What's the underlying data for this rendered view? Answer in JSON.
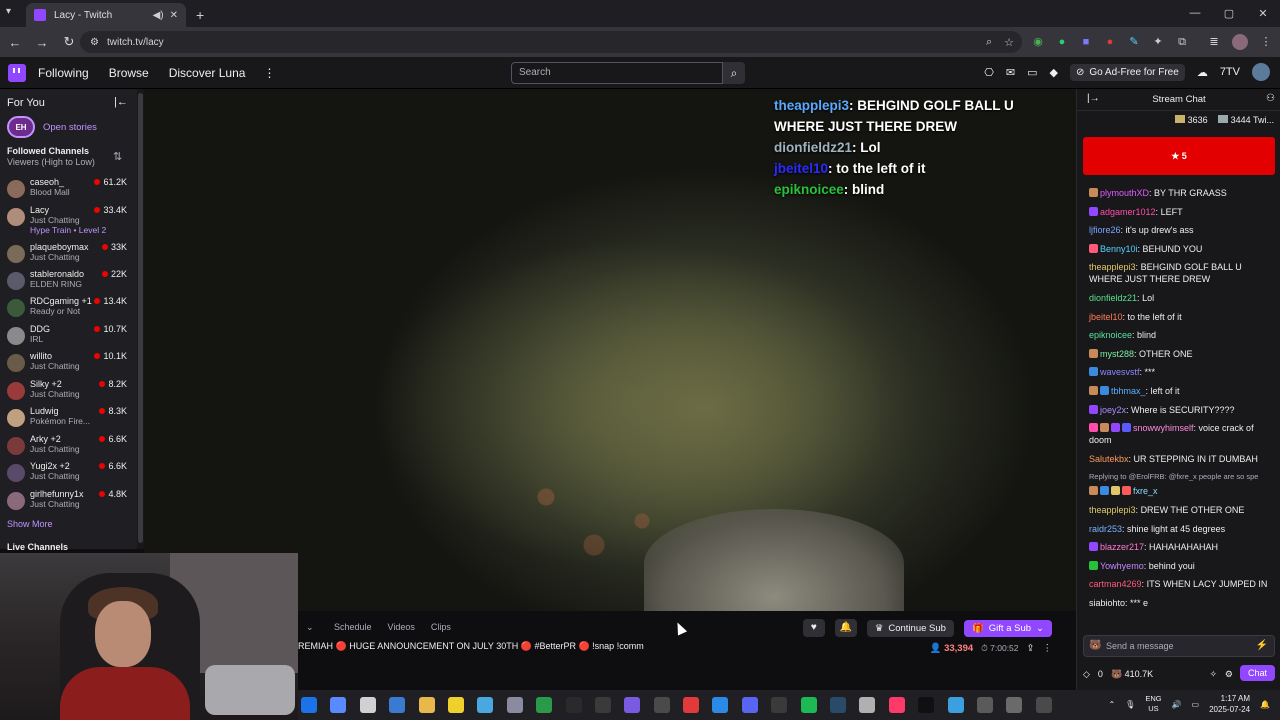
{
  "browser": {
    "tab_title": "Lacy - Twitch",
    "url": "twitch.tv/lacy"
  },
  "nav": {
    "following": "Following",
    "browse": "Browse",
    "discover": "Discover Luna",
    "search_placeholder": "Search",
    "adfree": "Go Ad-Free for Free"
  },
  "sidebar": {
    "for_you": "For You",
    "open_stories": "Open stories",
    "stories_badge": "EH",
    "followed_title": "Followed Channels",
    "followed_sort": "Viewers (High to Low)",
    "channels": [
      {
        "name": "caseoh_",
        "game": "Blood Mall",
        "viewers": "61.2K",
        "color": "#8a6a5a"
      },
      {
        "name": "Lacy",
        "game": "Just Chatting",
        "extra": "Hype Train • Level 2",
        "viewers": "33.4K",
        "color": "#b08c7a"
      },
      {
        "name": "plaqueboymax",
        "game": "Just Chatting",
        "viewers": "33K",
        "color": "#7a6a58"
      },
      {
        "name": "stableronaldo",
        "game": "ELDEN RING",
        "viewers": "22K",
        "color": "#5a5a6a"
      },
      {
        "name": "RDCgaming +1",
        "game": "Ready or Not",
        "viewers": "13.4K",
        "color": "#3a5a3a"
      },
      {
        "name": "DDG",
        "game": "IRL",
        "viewers": "10.7K",
        "color": "#8a8a8a"
      },
      {
        "name": "willito",
        "game": "Just Chatting",
        "viewers": "10.1K",
        "color": "#6a5a4a"
      },
      {
        "name": "Silky +2",
        "game": "Just Chatting",
        "viewers": "8.2K",
        "color": "#9a3a3a"
      },
      {
        "name": "Ludwig",
        "game": "Pokémon Fire...",
        "viewers": "8.3K",
        "color": "#c0a080"
      },
      {
        "name": "Arky +2",
        "game": "Just Chatting",
        "viewers": "6.6K",
        "color": "#7a3a3a"
      },
      {
        "name": "Yugi2x +2",
        "game": "Just Chatting",
        "viewers": "6.6K",
        "color": "#5a4a6a"
      },
      {
        "name": "girlhefunny1x",
        "game": "Just Chatting",
        "viewers": "4.8K",
        "color": "#8a6a7a"
      }
    ],
    "show_more": "Show More",
    "live_channels": "Live Channels"
  },
  "overlay_chat": [
    {
      "user": "theapplepi3",
      "text": "BEHGIND GOLF BALL U WHERE JUST THERE DREW",
      "color": "#5aa9ff"
    },
    {
      "user": "dionfieldz21",
      "text": "Lol",
      "color": "#9fb4c0"
    },
    {
      "user": "jbeitel10",
      "text": "to the left of it",
      "color": "#2b2bff"
    },
    {
      "user": "epiknoicee",
      "text": "blind",
      "color": "#27c23a"
    }
  ],
  "below": {
    "schedule": "Schedule",
    "videos": "Videos",
    "clips": "Clips",
    "title": "REMIAH 🔴 HUGE ANNOUNCEMENT ON JULY 30TH 🔴 #BetterPR 🔴 !snap !comm",
    "continue_sub": "Continue Sub",
    "gift_sub": "Gift a Sub",
    "viewers": "33,394",
    "uptime": "7:00:52"
  },
  "chat": {
    "title": "Stream Chat",
    "board1": "3636",
    "board2": "3444",
    "board2_label": "Twi...",
    "hype": "5",
    "messages": [
      {
        "user": "plymouthXD",
        "text": "BY THR GRAASS",
        "color": "#e05cff",
        "badges": [
          "#c98a5a"
        ]
      },
      {
        "user": "adgamer1012",
        "text": "LEFT",
        "color": "#ff4fa8",
        "badges": [
          "#9147ff"
        ]
      },
      {
        "user": "ljfiore26",
        "text": "it's up drew's ass",
        "color": "#7aa7ff",
        "badges": []
      },
      {
        "user": "Benny10i",
        "text": "BEHUND YOU",
        "color": "#5ad0ff",
        "badges": [
          "#ff5a7a"
        ]
      },
      {
        "user": "theapplepi3",
        "text": "BEHGIND GOLF BALL U WHERE JUST THERE DREW",
        "color": "#e0c86a",
        "badges": []
      },
      {
        "user": "dionfieldz21",
        "text": "Lol",
        "color": "#57e08a",
        "badges": []
      },
      {
        "user": "jbeitel10",
        "text": "to the left of it",
        "color": "#ff7a5a",
        "badges": []
      },
      {
        "user": "epiknoicee",
        "text": "blind",
        "color": "#57e0a0",
        "badges": []
      },
      {
        "user": "myst288",
        "text": "OTHER ONE",
        "color": "#7af0a0",
        "badges": [
          "#c98a5a"
        ]
      },
      {
        "user": "wavesvstf",
        "text": "***",
        "color": "#8a8aff",
        "badges": [
          "#3a8adf"
        ]
      },
      {
        "user": "tbhmax_",
        "text": "left of it",
        "color": "#5ab0ff",
        "badges": [
          "#c98a5a",
          "#3a8adf"
        ]
      },
      {
        "user": "joey2x",
        "text": "Where is SECURITY????",
        "color": "#b08aff",
        "badges": [
          "#9147ff"
        ]
      },
      {
        "user": "snowwyhimself",
        "text": "voice crack of doom",
        "color": "#ff8ae0",
        "badges": [
          "#ff4fa8",
          "#c98a5a",
          "#9147ff",
          "#5a5aff"
        ]
      },
      {
        "user": "Salutekbx",
        "text": "UR STEPPING IN IT DUMBAH",
        "color": "#ff9a5a",
        "badges": []
      },
      {
        "user": "fxre_x",
        "text": "",
        "color": "#8adfff",
        "badges": [
          "#c98a5a",
          "#3a8adf",
          "#e0c86a",
          "#ff5a5a"
        ],
        "reply": "Replying to @ErolFRB: @fxre_x people are so spe"
      },
      {
        "user": "theapplepi3",
        "text": "DREW THE OTHER ONE",
        "color": "#e0c86a",
        "badges": []
      },
      {
        "user": "raidr253",
        "text": "shine light at 45 degrees",
        "color": "#7ab0ff",
        "badges": []
      },
      {
        "user": "blazzer217",
        "text": "HAHAHAHAHAH",
        "color": "#ff7ad0",
        "badges": [
          "#9147ff"
        ]
      },
      {
        "user": "Yowhyemo",
        "text": "behind youi",
        "color": "#c58aff",
        "badges": [
          "#27c23a"
        ]
      },
      {
        "user": "cartman4269",
        "text": "ITS WHEN LACY JUMPED IN",
        "color": "#ff5a7a",
        "badges": []
      },
      {
        "user": "siabiohto",
        "text": "*** e",
        "color": "#efeff1",
        "badges": []
      }
    ],
    "input_placeholder": "Send a message",
    "points_left": "0",
    "points": "410.7K",
    "chat_button": "Chat"
  },
  "taskbar": {
    "lang1": "ENG",
    "lang2": "US",
    "time": "1:17 AM",
    "date": "2025-07-24",
    "icons": [
      "#1a73e8",
      "#5a8aff",
      "#d0d0d0",
      "#3a7ad0",
      "#e8b84a",
      "#f0d02a",
      "#4aa8e0",
      "#8a8aa0",
      "#2a9a4a",
      "#2a2a2a",
      "#3a3a3a",
      "#7a5ae0",
      "#4a4a4a",
      "#e03a3a",
      "#2a8ae8",
      "#5865f2",
      "#3a3a3a",
      "#1db954",
      "#2a4a6a",
      "#b0b0b0",
      "#ff3a6a",
      "#101010",
      "#3aa0e0",
      "#5a5a5a",
      "#6a6a6a",
      "#4a4a4a"
    ]
  }
}
